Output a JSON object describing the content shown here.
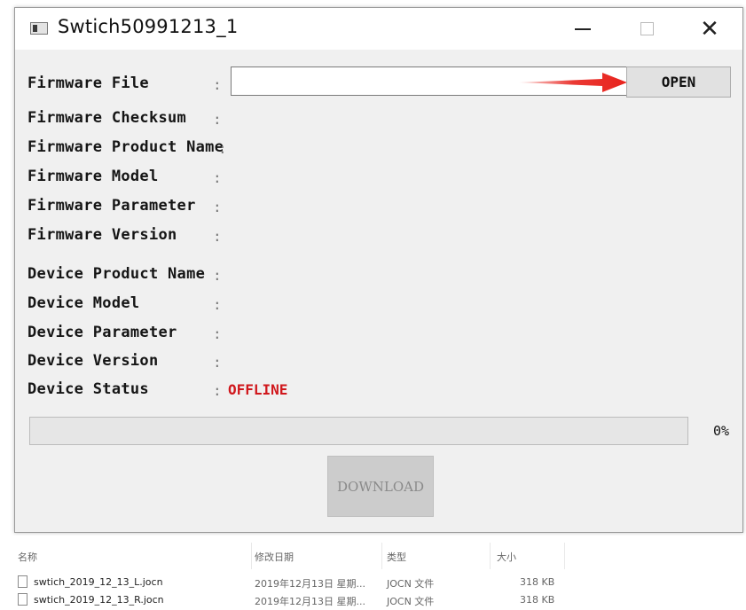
{
  "window": {
    "title": "Swtich50991213_1",
    "minimize_glyph": "—",
    "close_glyph": "✕"
  },
  "fields": [
    {
      "label": "Firmware File",
      "colon": ":"
    },
    {
      "label": "Firmware Checksum",
      "colon": ":"
    },
    {
      "label": "Firmware Product Name",
      "colon": ":"
    },
    {
      "label": "Firmware Model",
      "colon": ":"
    },
    {
      "label": "Firmware Parameter",
      "colon": ":"
    },
    {
      "label": "Firmware Version",
      "colon": ":"
    },
    {
      "label": "Device Product Name",
      "colon": ":"
    },
    {
      "label": "Device Model",
      "colon": ":"
    },
    {
      "label": "Device Parameter",
      "colon": ":"
    },
    {
      "label": "Device Version",
      "colon": ":"
    },
    {
      "label": "Device Status",
      "colon": ":",
      "value": "OFFLINE"
    }
  ],
  "firmware_file_input": {
    "value": "",
    "placeholder": ""
  },
  "open_button": {
    "label": "OPEN"
  },
  "progress": {
    "value": 0,
    "text": "0%"
  },
  "download_button": {
    "label": "DOWNLOAD",
    "enabled": false
  },
  "colors": {
    "status_offline": "#d0171c",
    "annotation_arrow": "#e8231d"
  },
  "explorer": {
    "columns": [
      "名称",
      "修改日期",
      "类型",
      "大小"
    ],
    "files": [
      {
        "name": "swtich_2019_12_13_L.jocn",
        "date": "2019年12月13日 星期...",
        "type": "JOCN 文件",
        "size": "318 KB"
      },
      {
        "name": "swtich_2019_12_13_R.jocn",
        "date": "2019年12月13日 星期...",
        "type": "JOCN 文件",
        "size": "318 KB"
      }
    ]
  }
}
